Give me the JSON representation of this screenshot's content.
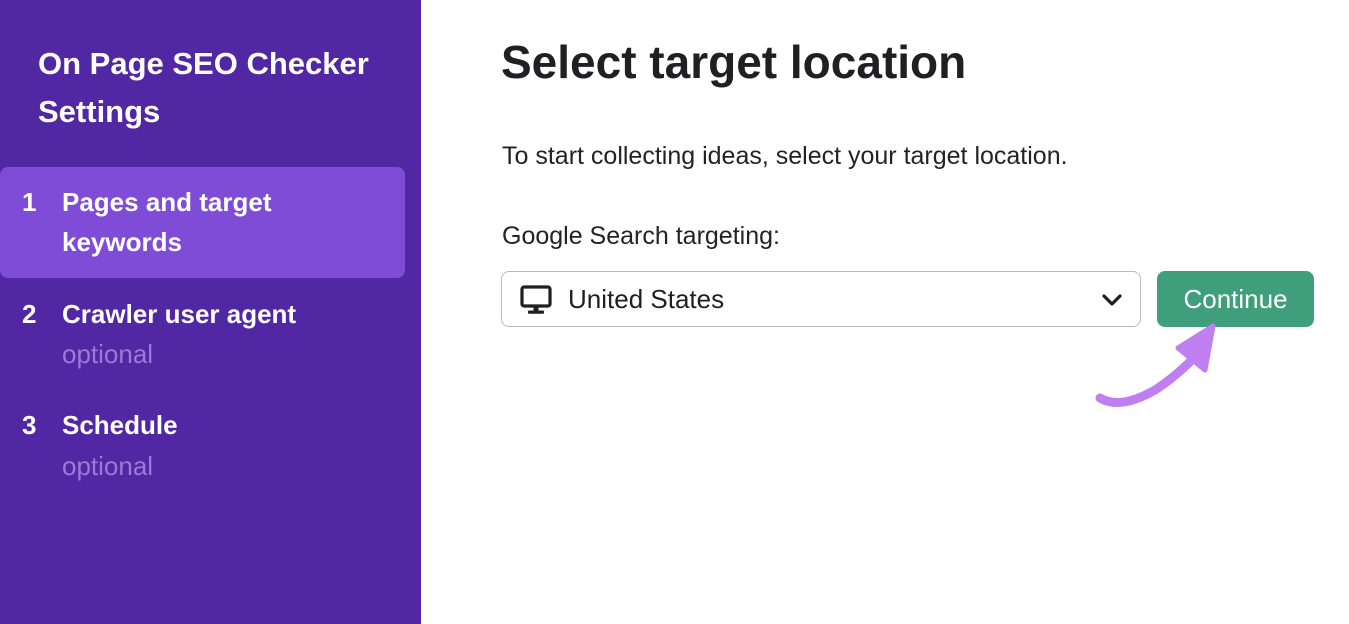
{
  "sidebar": {
    "title": "On Page SEO Checker Settings",
    "steps": [
      {
        "number": "1",
        "label": "Pages and target keywords",
        "sub": ""
      },
      {
        "number": "2",
        "label": "Crawler user agent",
        "sub": "optional"
      },
      {
        "number": "3",
        "label": "Schedule",
        "sub": "optional"
      }
    ]
  },
  "main": {
    "title": "Select target location",
    "description": "To start collecting ideas, select your target location.",
    "field_label": "Google Search targeting:",
    "select": {
      "icon": "monitor-icon",
      "value": "United States",
      "chevron": "chevron-down-icon"
    },
    "continue_label": "Continue"
  },
  "colors": {
    "sidebar_bg": "#5127a3",
    "active_step_bg": "#7e4cd6",
    "optional_text": "#9b7bd6",
    "continue_bg": "#3f9e7c",
    "annotation_arrow": "#c07ff0"
  }
}
